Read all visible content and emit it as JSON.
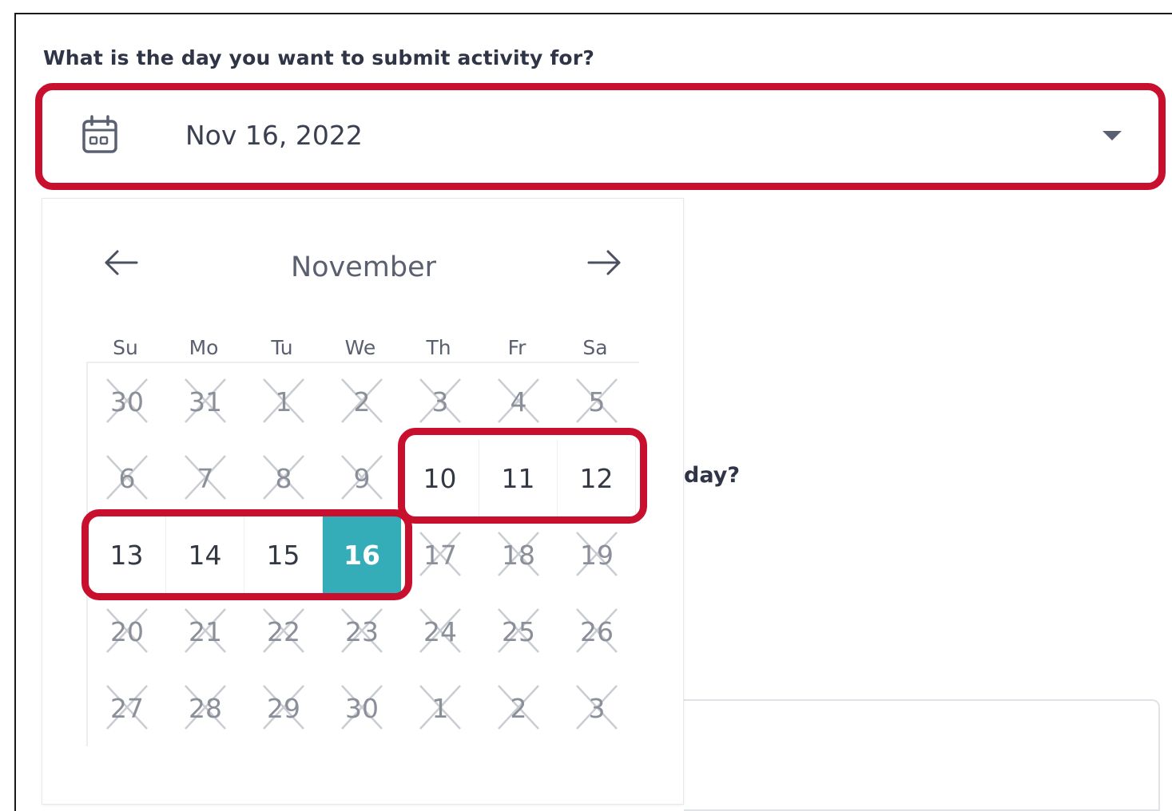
{
  "form": {
    "question": "What is the day you want to submit activity for?",
    "selected_date": "Nov 16, 2022",
    "partial_question_behind": "day?"
  },
  "calendar": {
    "month": "November",
    "weekdays": [
      "Su",
      "Mo",
      "Tu",
      "We",
      "Th",
      "Fr",
      "Sa"
    ],
    "weeks": [
      [
        {
          "d": "30",
          "s": "disabled"
        },
        {
          "d": "31",
          "s": "disabled"
        },
        {
          "d": "1",
          "s": "disabled"
        },
        {
          "d": "2",
          "s": "disabled"
        },
        {
          "d": "3",
          "s": "disabled"
        },
        {
          "d": "4",
          "s": "disabled"
        },
        {
          "d": "5",
          "s": "disabled"
        }
      ],
      [
        {
          "d": "6",
          "s": "disabled"
        },
        {
          "d": "7",
          "s": "disabled"
        },
        {
          "d": "8",
          "s": "disabled"
        },
        {
          "d": "9",
          "s": "disabled"
        },
        {
          "d": "10",
          "s": "enabled"
        },
        {
          "d": "11",
          "s": "enabled"
        },
        {
          "d": "12",
          "s": "enabled"
        }
      ],
      [
        {
          "d": "13",
          "s": "enabled"
        },
        {
          "d": "14",
          "s": "enabled"
        },
        {
          "d": "15",
          "s": "enabled"
        },
        {
          "d": "16",
          "s": "selected"
        },
        {
          "d": "17",
          "s": "disabled"
        },
        {
          "d": "18",
          "s": "disabled"
        },
        {
          "d": "19",
          "s": "disabled"
        }
      ],
      [
        {
          "d": "20",
          "s": "disabled"
        },
        {
          "d": "21",
          "s": "disabled"
        },
        {
          "d": "22",
          "s": "disabled"
        },
        {
          "d": "23",
          "s": "disabled"
        },
        {
          "d": "24",
          "s": "disabled"
        },
        {
          "d": "25",
          "s": "disabled"
        },
        {
          "d": "26",
          "s": "disabled"
        }
      ],
      [
        {
          "d": "27",
          "s": "disabled"
        },
        {
          "d": "28",
          "s": "disabled"
        },
        {
          "d": "29",
          "s": "disabled"
        },
        {
          "d": "30",
          "s": "disabled"
        },
        {
          "d": "1",
          "s": "disabled"
        },
        {
          "d": "2",
          "s": "disabled"
        },
        {
          "d": "3",
          "s": "disabled"
        }
      ]
    ]
  },
  "icons": {
    "date_field": "calendar-icon",
    "dropdown": "caret-down-icon",
    "prev": "arrow-left-icon",
    "next": "arrow-right-icon",
    "unavailable": "cross-out-icon"
  },
  "colors": {
    "highlight": "#c8102e",
    "selected_day": "#35adb9",
    "text_dark": "#2f3547",
    "text_muted": "#8a8f99"
  }
}
